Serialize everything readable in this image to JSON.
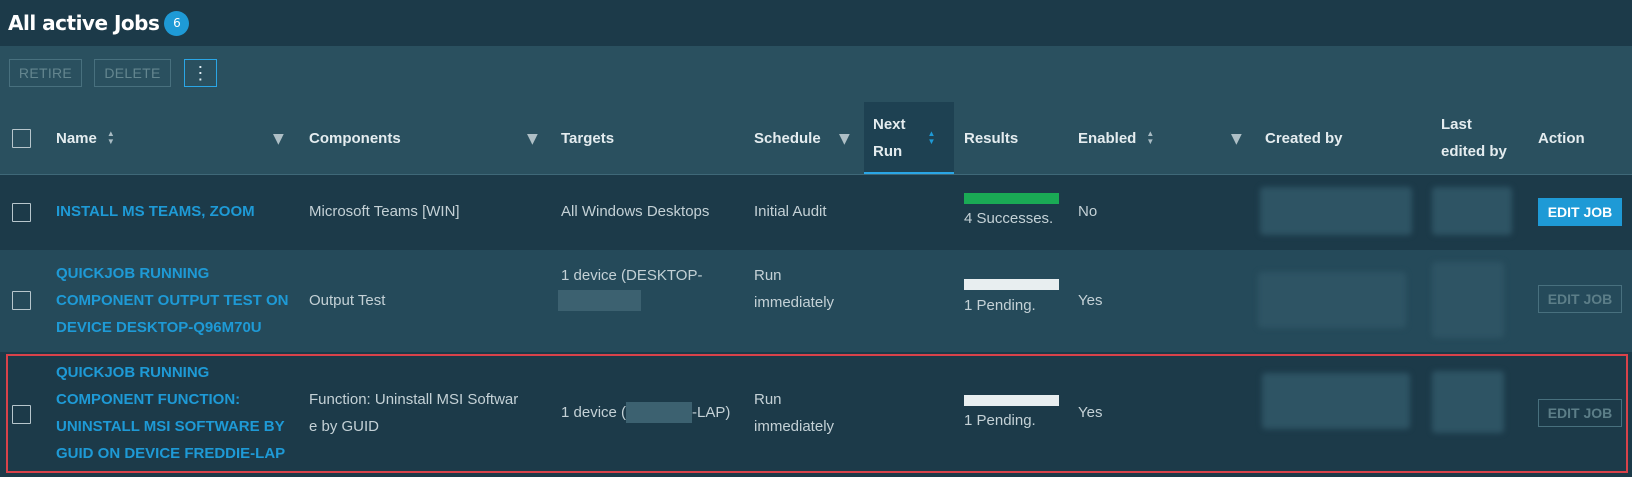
{
  "header": {
    "title": "All active Jobs",
    "count": "6"
  },
  "toolbar": {
    "retire_label": "RETIRE",
    "delete_label": "DELETE",
    "more_label": "⋮"
  },
  "columns": {
    "name": "Name",
    "components": "Components",
    "targets": "Targets",
    "schedule": "Schedule",
    "next_run_1": "Next",
    "next_run_2": "Run",
    "results": "Results",
    "enabled": "Enabled",
    "created_by": "Created by",
    "last_edited_1": "Last",
    "last_edited_2": "edited by",
    "action": "Action"
  },
  "rows": [
    {
      "name_lines": [
        "INSTALL MS TEAMS, ZOOM"
      ],
      "component_lines": [
        "Microsoft Teams [WIN]"
      ],
      "target_lines": [
        "All Windows Desktops"
      ],
      "schedule_lines": [
        "Initial Audit"
      ],
      "result_text": "4 Successes.",
      "result_status": "success",
      "enabled": "No",
      "action": "EDIT JOB"
    },
    {
      "name_lines": [
        "QUICKJOB RUNNING",
        "COMPONENT OUTPUT TEST ON",
        "DEVICE DESKTOP-Q96M70U"
      ],
      "component_lines": [
        "Output Test"
      ],
      "target_lines": [
        "1 device (DESKTOP-"
      ],
      "schedule_lines": [
        "Run",
        "immediately"
      ],
      "result_text": "1 Pending.",
      "result_status": "pending",
      "enabled": "Yes",
      "action": "EDIT JOB"
    },
    {
      "name_lines": [
        "QUICKJOB RUNNING",
        "COMPONENT FUNCTION:",
        "UNINSTALL MSI SOFTWARE BY",
        "GUID ON DEVICE FREDDIE-LAP"
      ],
      "component_lines": [
        "Function: Uninstall MSI Softwar",
        "e by GUID"
      ],
      "target_prefix": "1 device (",
      "target_suffix": "-LAP)",
      "schedule_lines": [
        "Run",
        "immediately"
      ],
      "result_text": "1 Pending.",
      "result_status": "pending",
      "enabled": "Yes",
      "action": "EDIT JOB"
    }
  ],
  "colors": {
    "accent": "#1e9ad6",
    "success": "#1aaa55",
    "pending": "#e8eef0",
    "highlight_outline": "#d9424a"
  }
}
